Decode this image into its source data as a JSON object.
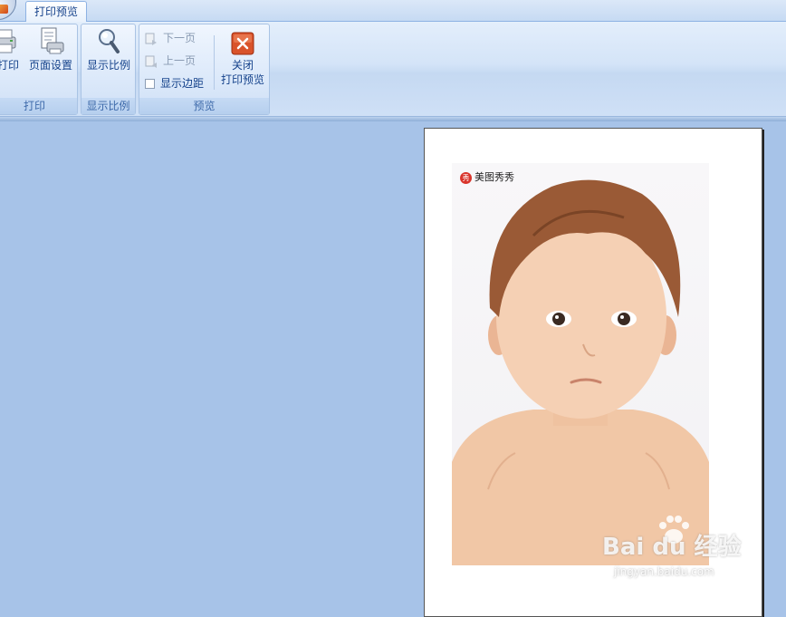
{
  "tabs": {
    "active_label": "打印预览"
  },
  "groups": {
    "print": {
      "label": "打印",
      "print_button": "打印",
      "page_setup_button": "页面设置"
    },
    "zoom": {
      "label": "显示比例",
      "zoom_button": "显示比例"
    },
    "preview": {
      "label": "预览",
      "next_page": "下一页",
      "prev_page": "上一页",
      "show_margins": "显示边距",
      "close_line1": "关闭",
      "close_line2": "打印预览"
    }
  },
  "photo": {
    "logo_glyph": "秀",
    "logo_text": "美图秀秀"
  },
  "watermark": {
    "brand": "Bai du 经验",
    "url": "jingyan.baidu.com"
  },
  "colors": {
    "workspace": "#a7c3e8",
    "ribbon_text": "#15428b",
    "close_icon": "#d0461c"
  },
  "icons": [
    "printer-icon",
    "page-setup-icon",
    "magnifier-icon",
    "next-page-icon",
    "prev-page-icon",
    "checkbox-icon",
    "close-x-icon"
  ]
}
